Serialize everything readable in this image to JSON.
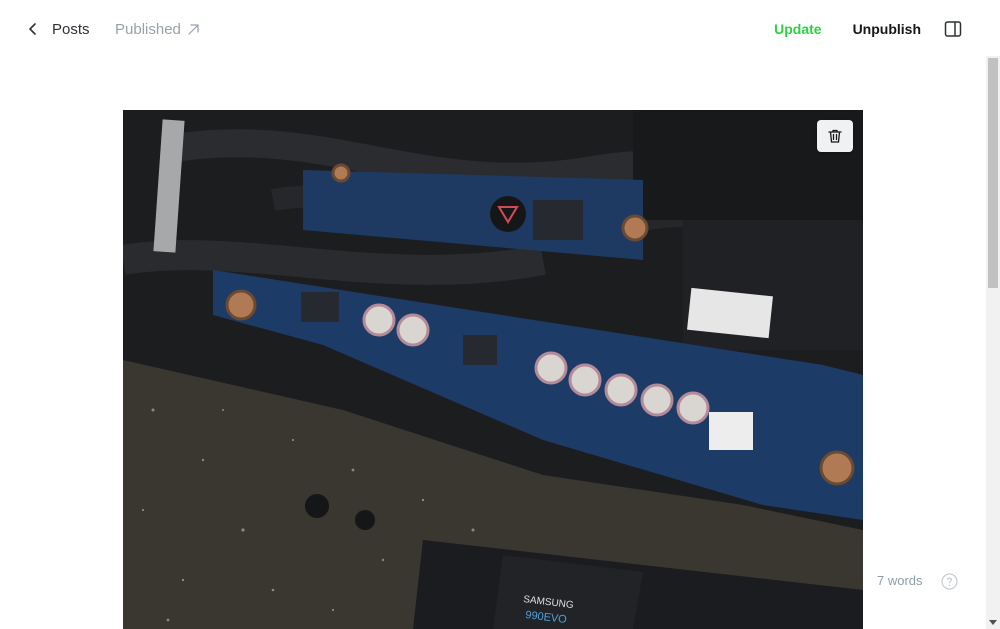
{
  "header": {
    "back_label": "Posts",
    "status_label": "Published",
    "update_label": "Update",
    "unpublish_label": "Unpublish"
  },
  "editor": {
    "word_count": "7 words"
  },
  "icons": {
    "back": "chevron-left-icon",
    "status_link": "arrow-up-right-icon",
    "sidebar": "sidebar-toggle-icon",
    "delete": "trash-icon",
    "help": "question-circle-icon"
  },
  "colors": {
    "update_green": "#30cf43",
    "muted_gray": "#98a1ab",
    "text_dark": "#15171a"
  }
}
